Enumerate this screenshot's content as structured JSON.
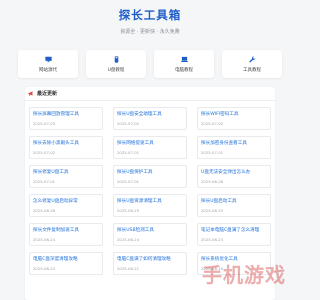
{
  "header": {
    "title": "探长工具箱",
    "subtitle": "資源全 · 更新快 · 永久免費"
  },
  "nav": [
    {
      "label": "网站源代",
      "icon": "monitor-icon"
    },
    {
      "label": "U盘教程",
      "icon": "usb-drive-icon"
    },
    {
      "label": "电脑教程",
      "icon": "laptop-icon"
    },
    {
      "label": "工具教程",
      "icon": "wrench-icon"
    }
  ],
  "recent": {
    "title": "最近更新",
    "items": [
      {
        "title": "探长屏幕回放管理工具",
        "date": "2025-07-03"
      },
      {
        "title": "探长U盘安全助理工具",
        "date": "2025-07-02"
      },
      {
        "title": "探长WIFI密码工具",
        "date": "2025-07-02"
      },
      {
        "title": "探长去除小黑眼头工具",
        "date": "2025-07-02"
      },
      {
        "title": "探长网络提速工具",
        "date": "2025-07-01"
      },
      {
        "title": "探长加密身份查看工具",
        "date": "2025-07-01"
      },
      {
        "title": "探长修复U盘工具",
        "date": "2025-07-01"
      },
      {
        "title": "探长U盘保护工具",
        "date": "2025-07-01"
      },
      {
        "title": "U盘无法安全弹出怎么办",
        "date": "2025-06-26"
      },
      {
        "title": "怎么修复U盘启动异常",
        "date": "2025-06-26"
      },
      {
        "title": "探长U盘资源清理工具",
        "date": "2025-06-25"
      },
      {
        "title": "探长U盘启动工具",
        "date": "2025-06-25"
      },
      {
        "title": "探长文件复制加速工具",
        "date": "2025-06-24"
      },
      {
        "title": "探长USB检测工具",
        "date": "2025-06-24"
      },
      {
        "title": "笔记本电脑C盘满了怎么清理",
        "date": "2025-06-23"
      },
      {
        "title": "电脑C盘深度清理攻略",
        "date": "2025-06-23"
      },
      {
        "title": "电脑C盘满了如何清理攻略",
        "date": "2025-06-21"
      },
      {
        "title": "探长系统优化工具",
        "date": "2025-06-19"
      }
    ]
  },
  "watermark": {
    "text": "手机游戏",
    "sub": ""
  },
  "colors": {
    "accent": "#1e5ec9",
    "link": "#1e6fd9",
    "background": "#f5f6f8"
  }
}
